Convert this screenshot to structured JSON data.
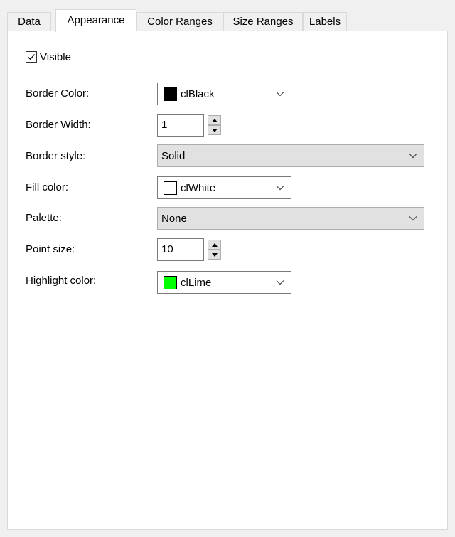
{
  "tabs": [
    {
      "label": "Data"
    },
    {
      "label": "Appearance"
    },
    {
      "label": "Color Ranges"
    },
    {
      "label": "Size Ranges"
    },
    {
      "label": "Labels"
    }
  ],
  "active_tab": "Appearance",
  "visible": {
    "label": "Visible",
    "checked": true
  },
  "border_color": {
    "label": "Border Color:",
    "value": "clBlack",
    "swatch": "#000000"
  },
  "border_width": {
    "label": "Border Width:",
    "value": "1"
  },
  "border_style": {
    "label": "Border style:",
    "value": "Solid"
  },
  "fill_color": {
    "label": "Fill color:",
    "value": "clWhite",
    "swatch": "#ffffff"
  },
  "palette": {
    "label": "Palette:",
    "value": "None"
  },
  "point_size": {
    "label": "Point size:",
    "value": "10"
  },
  "highlight_color": {
    "label": "Highlight color:",
    "value": "clLime",
    "swatch": "#00ff00"
  },
  "icons": {
    "checkmark": "checkmark-icon",
    "dropdown": "chevron-down-icon",
    "spin_up": "spin-up-arrow-icon",
    "spin_down": "spin-down-arrow-icon"
  }
}
